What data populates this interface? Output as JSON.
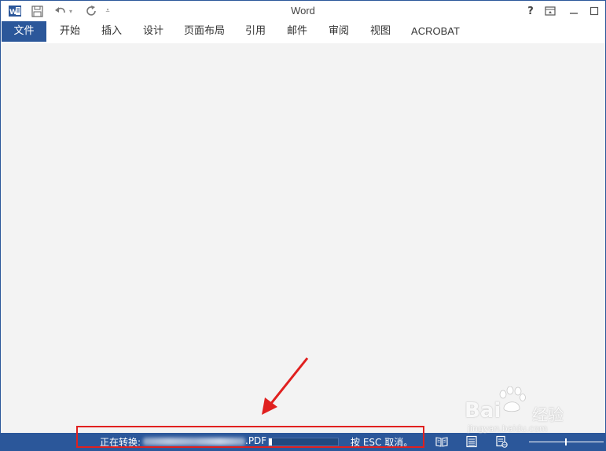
{
  "window": {
    "title": "Word"
  },
  "quick_access": {
    "app_icon": "word-app-icon",
    "save_icon": "save-icon",
    "undo_icon": "undo-icon",
    "redo_icon": "redo-icon",
    "customize_icon": "customize-qat-icon"
  },
  "window_controls": {
    "help": "?",
    "ribbon_display_icon": "ribbon-display-icon",
    "minimize_icon": "minimize-icon",
    "restore_icon": "restore-icon"
  },
  "ribbon": {
    "tabs": [
      {
        "label": "文件"
      },
      {
        "label": "开始"
      },
      {
        "label": "插入"
      },
      {
        "label": "设计"
      },
      {
        "label": "页面布局"
      },
      {
        "label": "引用"
      },
      {
        "label": "邮件"
      },
      {
        "label": "审阅"
      },
      {
        "label": "视图"
      },
      {
        "label": "ACROBAT"
      }
    ]
  },
  "statusbar": {
    "converting_label": "正在转换:",
    "file_ext": ".PDF",
    "progress_fraction": 0.05,
    "cancel_hint": "按 ESC 取消。",
    "read_mode_icon": "read-mode-icon",
    "print_layout_icon": "print-layout-icon",
    "web_layout_icon": "web-layout-icon"
  },
  "watermark": {
    "brand": "Bai",
    "brand_cn": "经验",
    "url": "jingyan.baidu.com"
  },
  "colors": {
    "accent": "#2b579a",
    "highlight": "#e0201f"
  }
}
